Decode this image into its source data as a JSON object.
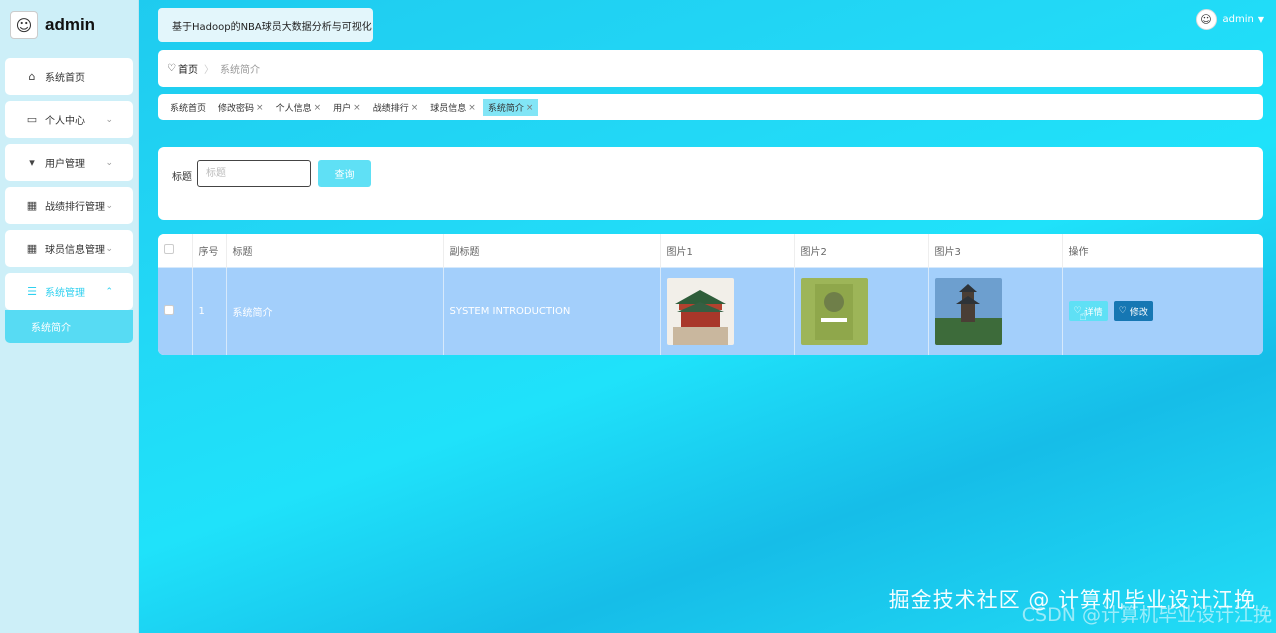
{
  "app": {
    "brand_name": "admin",
    "system_title": "基于Hadoop的NBA球员大数据分析与可视化",
    "user_name": "admin"
  },
  "sidebar": {
    "items": [
      {
        "label": "系统首页",
        "icon": "home-icon"
      },
      {
        "label": "个人中心",
        "icon": "credit-card-icon"
      },
      {
        "label": "用户管理",
        "icon": "pin-icon"
      },
      {
        "label": "战绩排行管理",
        "icon": "grid-icon"
      },
      {
        "label": "球员信息管理",
        "icon": "grid-icon"
      },
      {
        "label": "系统管理",
        "icon": "menu-icon"
      }
    ],
    "submenu_active": "系统简介"
  },
  "breadcrumb": {
    "home": "首页",
    "current": "系统简介"
  },
  "tags": [
    {
      "label": "系统首页",
      "closable": false
    },
    {
      "label": "修改密码",
      "closable": true
    },
    {
      "label": "个人信息",
      "closable": true
    },
    {
      "label": "用户",
      "closable": true
    },
    {
      "label": "战绩排行",
      "closable": true
    },
    {
      "label": "球员信息",
      "closable": true
    },
    {
      "label": "系统简介",
      "closable": true,
      "active": true
    }
  ],
  "search": {
    "label": "标题",
    "placeholder": "标题",
    "button": "查询"
  },
  "table": {
    "headers": [
      "序号",
      "标题",
      "副标题",
      "图片1",
      "图片2",
      "图片3",
      "操作"
    ],
    "rows": [
      {
        "index": "1",
        "title": "系统简介",
        "subtitle": "SYSTEM INTRODUCTION"
      }
    ],
    "actions": {
      "detail": "详情",
      "edit": "修改"
    }
  },
  "watermark": {
    "line1": "掘金技术社区 @ 计算机毕业设计江挽",
    "line2": "CSDN @计算机毕业设计江挽"
  },
  "colors": {
    "accent": "#5fe0f5",
    "edit": "#1677b3",
    "row_bg": "#a3cffb"
  }
}
